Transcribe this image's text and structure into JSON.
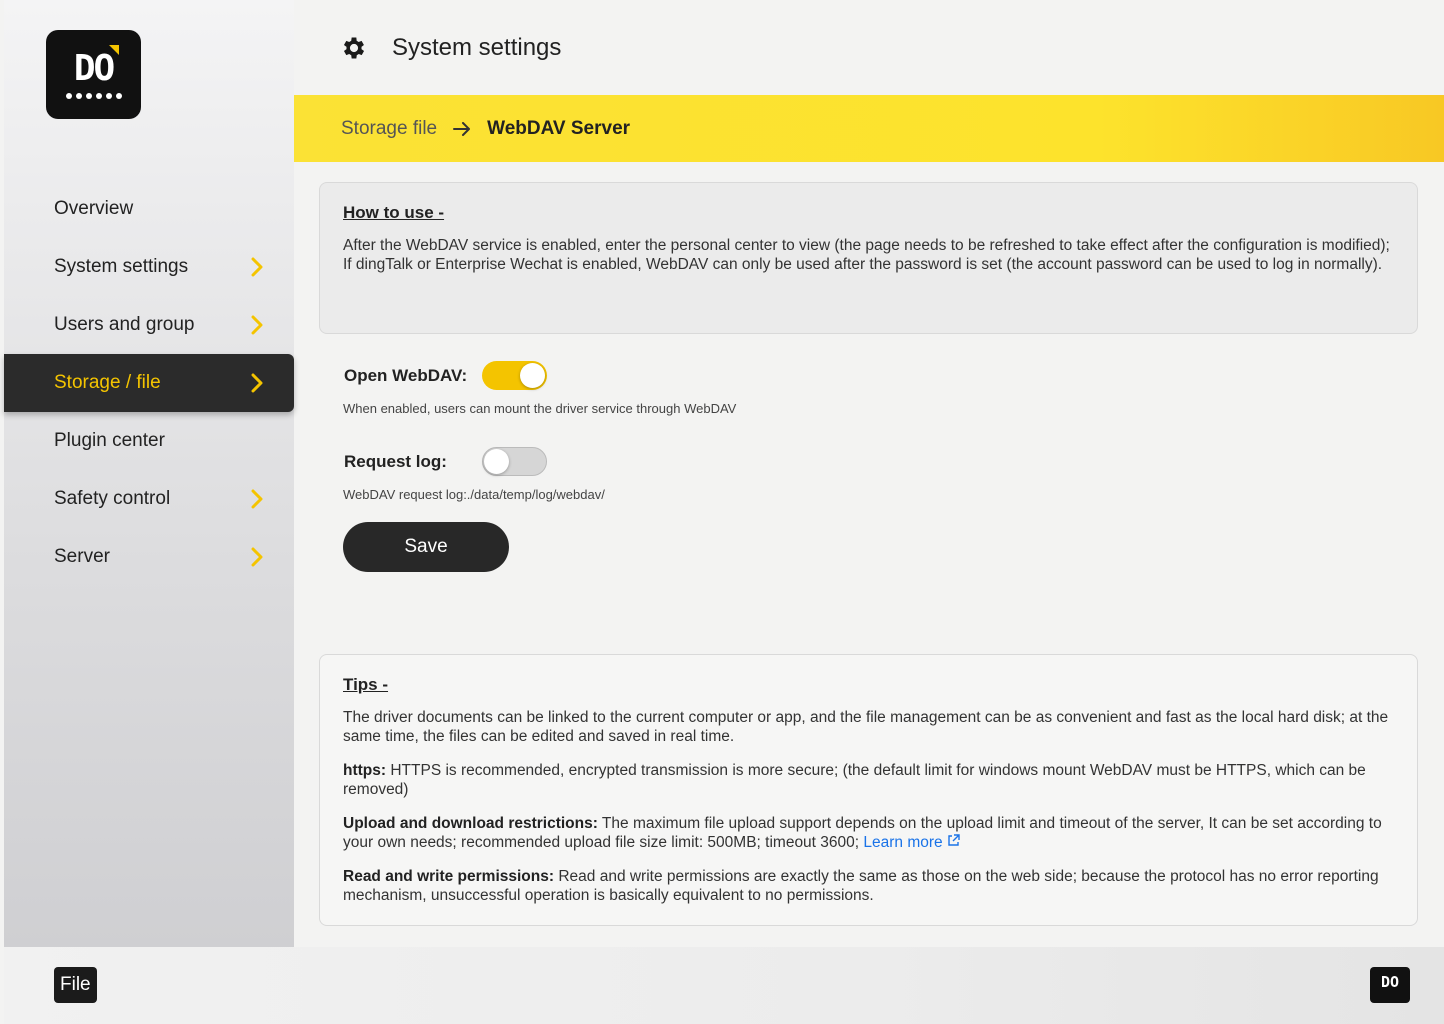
{
  "logo": {
    "text": "DΟ"
  },
  "sidebar": {
    "items": [
      {
        "label": "Overview",
        "has_chevron": false
      },
      {
        "label": "System settings",
        "has_chevron": true
      },
      {
        "label": "Users and group",
        "has_chevron": true
      },
      {
        "label": "Storage / file",
        "has_chevron": true,
        "active": true
      },
      {
        "label": "Plugin center",
        "has_chevron": false
      },
      {
        "label": "Safety control",
        "has_chevron": true
      },
      {
        "label": "Server",
        "has_chevron": true
      }
    ]
  },
  "header": {
    "title": "System settings",
    "icon": "gear-icon"
  },
  "breadcrumb": {
    "parent": "Storage file",
    "current": "WebDAV Server"
  },
  "howto": {
    "title": "How to use -",
    "line1": "After the WebDAV service is enabled, enter the personal center to view  (the page needs to be refreshed to take effect after the configuration is modified);",
    "line2": "If dingTalk or Enterprise Wechat is enabled, WebDAV can only be used after the password is set  (the account password can be used to log in normally)."
  },
  "form": {
    "open_webdav_label": "Open WebDAV:",
    "open_webdav_on": true,
    "open_webdav_hint": "When enabled, users can mount the driver service through  WebDAV",
    "request_log_label": "Request log:",
    "request_log_on": false,
    "request_log_hint": "WebDAV request log:./data/temp/log/webdav/",
    "save_label": "Save"
  },
  "tips": {
    "title": "Tips -",
    "p1": "The driver documents can be linked to the current computer or app, and the file management can be as convenient and fast as the local hard disk; at the same time, the files can be edited and saved in real time.",
    "p2_label": "https:",
    "p2": " HTTPS is recommended, encrypted transmission is more secure; (the default limit for windows mount WebDAV must be HTTPS, which can be removed)",
    "p3_label": "Upload and download restrictions:",
    "p3": " The maximum file upload support depends on the upload limit and timeout of the server, It can be set according to your own needs; recommended upload file size limit: 500MB; timeout 3600; ",
    "p3_link": "Learn more",
    "p4_label": "Read and write permissions:",
    "p4": " Read and write permissions are exactly the same as those on the web side; because the protocol has no error reporting mechanism, unsuccessful operation is basically equivalent to no permissions."
  },
  "bottom": {
    "file_label": "File"
  },
  "colors": {
    "accent": "#f4c400",
    "dark": "#2b2b2b",
    "link": "#1a73e8"
  }
}
